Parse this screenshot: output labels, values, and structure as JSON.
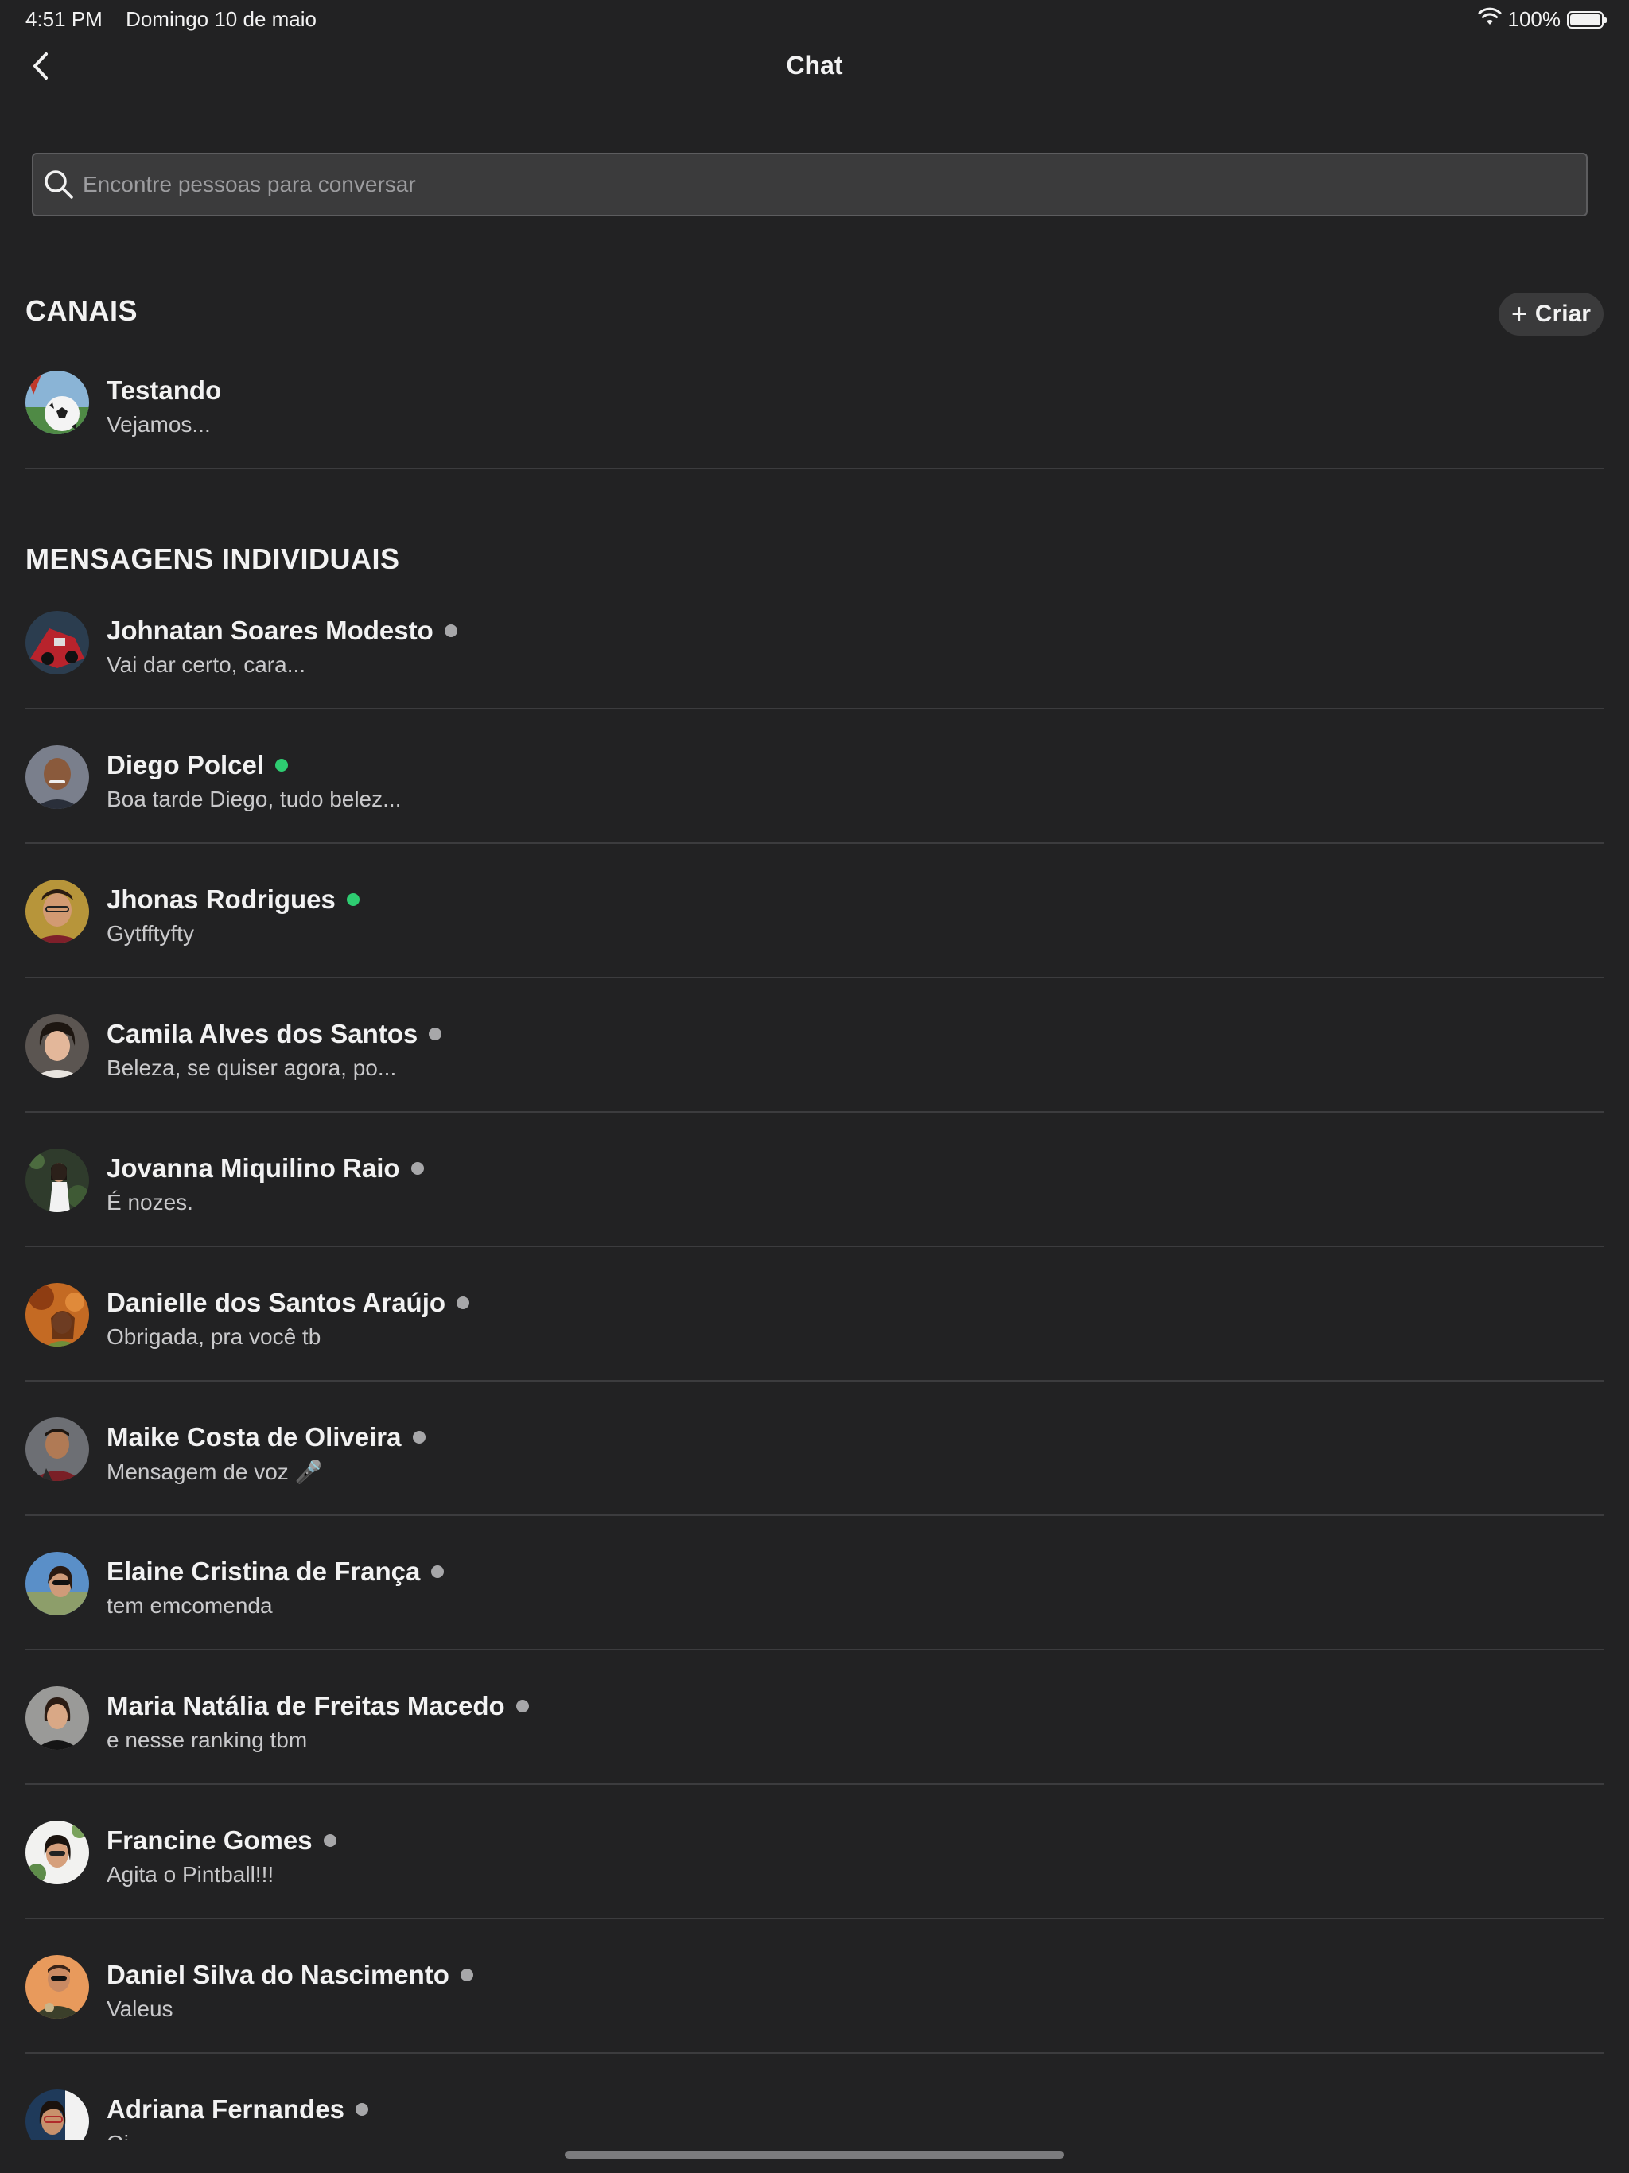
{
  "status_bar": {
    "time": "4:51 PM",
    "date": "Domingo 10 de maio",
    "battery": "100%",
    "battery_level": 1.0
  },
  "nav": {
    "title": "Chat",
    "back_icon": "chevron-left-icon"
  },
  "search": {
    "placeholder": "Encontre pessoas para conversar",
    "value": ""
  },
  "channels": {
    "title": "CANAIS",
    "create_label": "Criar",
    "items": [
      {
        "name": "Testando",
        "preview": "Vejamos..."
      }
    ]
  },
  "direct": {
    "title": "MENSAGENS INDIVIDUAIS",
    "items": [
      {
        "name": "Johnatan Soares Modesto",
        "preview": "Vai dar certo, cara...",
        "online": false
      },
      {
        "name": "Diego Polcel",
        "preview": "Boa tarde Diego, tudo belez...",
        "online": true
      },
      {
        "name": "Jhonas Rodrigues",
        "preview": "Gytfftyfty",
        "online": true
      },
      {
        "name": "Camila Alves dos Santos",
        "preview": "Beleza, se quiser agora, po...",
        "online": false
      },
      {
        "name": "Jovanna Miquilino Raio",
        "preview": "É nozes.",
        "online": false
      },
      {
        "name": "Danielle dos Santos Araújo",
        "preview": "Obrigada, pra você tb",
        "online": false
      },
      {
        "name": "Maike Costa de Oliveira",
        "preview": "Mensagem de voz 🎤",
        "online": false
      },
      {
        "name": "Elaine Cristina de França",
        "preview": "tem emcomenda",
        "online": false
      },
      {
        "name": "Maria Natália de Freitas Macedo",
        "preview": "e nesse ranking tbm",
        "online": false
      },
      {
        "name": "Francine Gomes",
        "preview": "Agita o Pintball!!!",
        "online": false
      },
      {
        "name": "Daniel Silva do Nascimento",
        "preview": "Valeus",
        "online": false
      },
      {
        "name": "Adriana Fernandes",
        "preview": "Oi",
        "online": false
      }
    ]
  },
  "colors": {
    "background": "#222223",
    "online": "#2ecc71",
    "offline": "#a7a7a9"
  }
}
